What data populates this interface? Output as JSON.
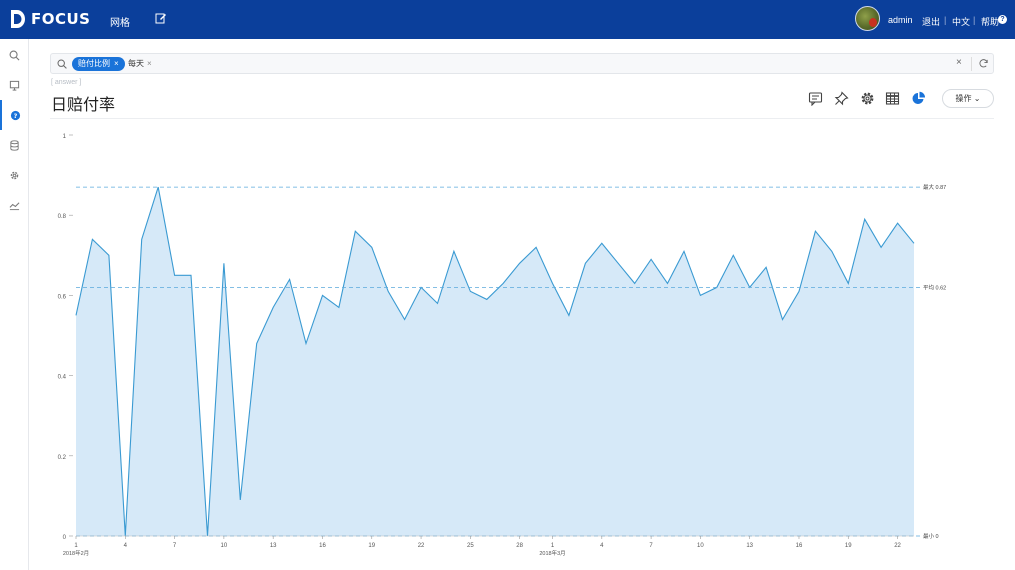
{
  "header": {
    "logo_text": "FOCUS",
    "nav_grid": "网格",
    "user_name": "admin",
    "logout": "退出",
    "lang": "中文",
    "help": "帮助",
    "bg_color": "#0b3f9b"
  },
  "sidebar": {
    "items": [
      "search-icon",
      "board-icon",
      "question-icon",
      "database-icon",
      "settings-icon",
      "trend-icon"
    ],
    "active_index": 2
  },
  "search": {
    "chip_label": "赔付比例",
    "token_label": "每天"
  },
  "main": {
    "subhint": "[ answer ]",
    "title": "日赔付率",
    "ops_label": "操作",
    "toolbar_icons": [
      "comment-icon",
      "pin-icon",
      "gear-icon",
      "table-icon",
      "pie-icon"
    ]
  },
  "chart_data": {
    "type": "area",
    "title": "日赔付率",
    "y_ticks": [
      "0",
      "0.2",
      "0.4",
      "0.6",
      "0.8",
      "1"
    ],
    "ylim": [
      0,
      1
    ],
    "x_tick_labels": [
      "1",
      "4",
      "7",
      "10",
      "13",
      "16",
      "19",
      "22",
      "25",
      "28",
      "1",
      "4",
      "7",
      "10",
      "13",
      "16",
      "19",
      "22"
    ],
    "x_tick_indices": [
      0,
      3,
      6,
      9,
      12,
      15,
      18,
      21,
      24,
      27,
      29,
      32,
      35,
      38,
      41,
      44,
      47,
      50
    ],
    "month_labels": [
      {
        "label": "2018年2月",
        "index": 0
      },
      {
        "label": "2018年3月",
        "index": 29
      }
    ],
    "reference_lines": [
      {
        "label": "最大 0.87",
        "value": 0.87
      },
      {
        "label": "平均 0.62",
        "value": 0.62
      },
      {
        "label": "最小 0",
        "value": 0
      }
    ],
    "values": [
      0.55,
      0.74,
      0.7,
      0.0,
      0.74,
      0.87,
      0.65,
      0.65,
      0.0,
      0.68,
      0.09,
      0.48,
      0.57,
      0.64,
      0.48,
      0.6,
      0.57,
      0.76,
      0.72,
      0.61,
      0.54,
      0.62,
      0.58,
      0.71,
      0.61,
      0.59,
      0.63,
      0.68,
      0.72,
      0.63,
      0.55,
      0.68,
      0.73,
      0.68,
      0.63,
      0.69,
      0.63,
      0.71,
      0.6,
      0.62,
      0.7,
      0.62,
      0.67,
      0.54,
      0.61,
      0.76,
      0.71,
      0.63,
      0.79,
      0.72,
      0.78,
      0.73
    ],
    "colors": {
      "line": "#3a9ad2",
      "fill": "#d6e9f8",
      "ref": "#5aa9dc",
      "accent": "#1a73d9"
    }
  }
}
